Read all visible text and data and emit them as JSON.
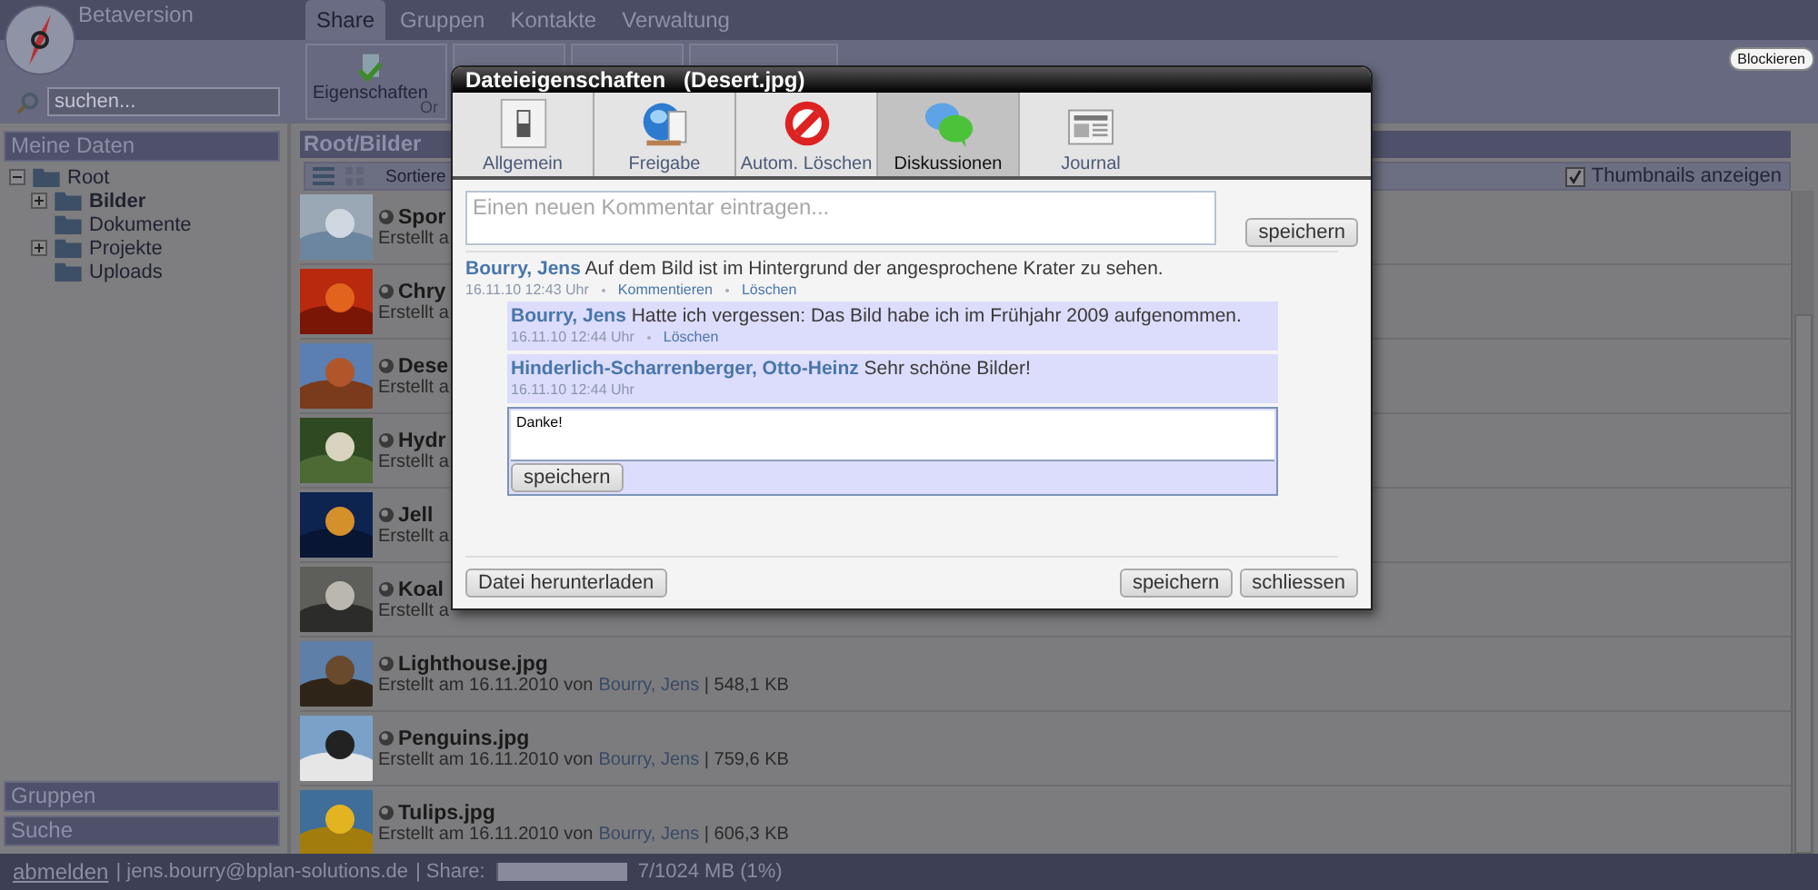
{
  "app": {
    "title": "Betaversion"
  },
  "main_tabs": [
    {
      "label": "Share",
      "selected": true
    },
    {
      "label": "Gruppen",
      "selected": false
    },
    {
      "label": "Kontakte",
      "selected": false
    },
    {
      "label": "Verwaltung",
      "selected": false
    }
  ],
  "search": {
    "placeholder": "suchen..."
  },
  "toolbar": {
    "button": "Eigenschaften",
    "group_label": "Or"
  },
  "block_button": "Blockieren",
  "sidebar": {
    "header": "Meine Daten",
    "tree": [
      {
        "label": "Root",
        "expanded": true,
        "selected": false,
        "children": [
          {
            "label": "Bilder",
            "expanded": false,
            "selected": true
          },
          {
            "label": "Dokumente",
            "selected": false
          },
          {
            "label": "Projekte",
            "expanded": false,
            "selected": false
          },
          {
            "label": "Uploads",
            "selected": false
          }
        ]
      }
    ],
    "bottom_sections": [
      "Gruppen",
      "Suche"
    ]
  },
  "folder": {
    "path": "Root/Bilder",
    "sort_label": "Sortiere",
    "thumbnails": {
      "label": "Thumbnails anzeigen",
      "checked": true
    },
    "files": [
      {
        "name": "Spor",
        "detail": "Erstellt a"
      },
      {
        "name": "Chry",
        "detail": "Erstellt a"
      },
      {
        "name": "Dese",
        "detail": "Erstellt a"
      },
      {
        "name": "Hydr",
        "detail": "Erstellt a"
      },
      {
        "name": "Jell",
        "detail": "Erstellt a"
      },
      {
        "name": "Koal",
        "detail": "Erstellt a"
      },
      {
        "name": "Lighthouse.jpg",
        "detail": "Erstellt am 16.11.2010 von",
        "owner": "Bourry, Jens",
        "size": "| 548,1 KB"
      },
      {
        "name": "Penguins.jpg",
        "detail": "Erstellt am 16.11.2010 von",
        "owner": "Bourry, Jens",
        "size": "| 759,6 KB"
      },
      {
        "name": "Tulips.jpg",
        "detail": "Erstellt am 16.11.2010 von",
        "owner": "Bourry, Jens",
        "size": "| 606,3 KB"
      }
    ]
  },
  "status_bar": {
    "logout": "abmelden",
    "account": "| jens.bourry@bplan-solutions.de",
    "share_label": "| Share:",
    "share_bar": {
      "level": 0.01
    },
    "share_text": "7/1024 MB (1%)"
  },
  "dialog": {
    "title": "Dateieigenschaften   (Desert.jpg)",
    "tabs": [
      {
        "label": "Allgemein",
        "kind": "switch",
        "selected": false
      },
      {
        "label": "Freigabe",
        "kind": "globe",
        "selected": false
      },
      {
        "label": "Autom. Löschen",
        "kind": "forbidden",
        "selected": false
      },
      {
        "label": "Diskussionen",
        "kind": "chat",
        "selected": true
      },
      {
        "label": "Journal",
        "kind": "newspaper",
        "selected": false
      }
    ],
    "new_comment": {
      "placeholder": "Einen neuen Kommentar eintragen...",
      "button": "speichern"
    },
    "comments": [
      {
        "author": "Bourry, Jens",
        "text": "Auf dem Bild ist im Hintergrund der angesprochene Krater zu sehen.",
        "time": "16.11.10 12:43 Uhr",
        "actions": [
          "Kommentieren",
          "Löschen"
        ],
        "replies": [
          {
            "author": "Bourry, Jens",
            "text": "Hatte ich vergessen: Das Bild habe ich im Frühjahr 2009 aufgenommen.",
            "time": "16.11.10 12:44 Uhr",
            "actions": [
              "Löschen"
            ]
          },
          {
            "author": "Hinderlich-Scharrenberger, Otto-Heinz",
            "text": "Sehr schöne Bilder!",
            "time": "16.11.10 12:44 Uhr"
          }
        ],
        "reply_box": {
          "value": "Danke!",
          "button": "speichern"
        }
      }
    ],
    "footer": {
      "download": "Datei herunterladen",
      "buttons": [
        "speichern",
        "schliessen"
      ]
    }
  }
}
